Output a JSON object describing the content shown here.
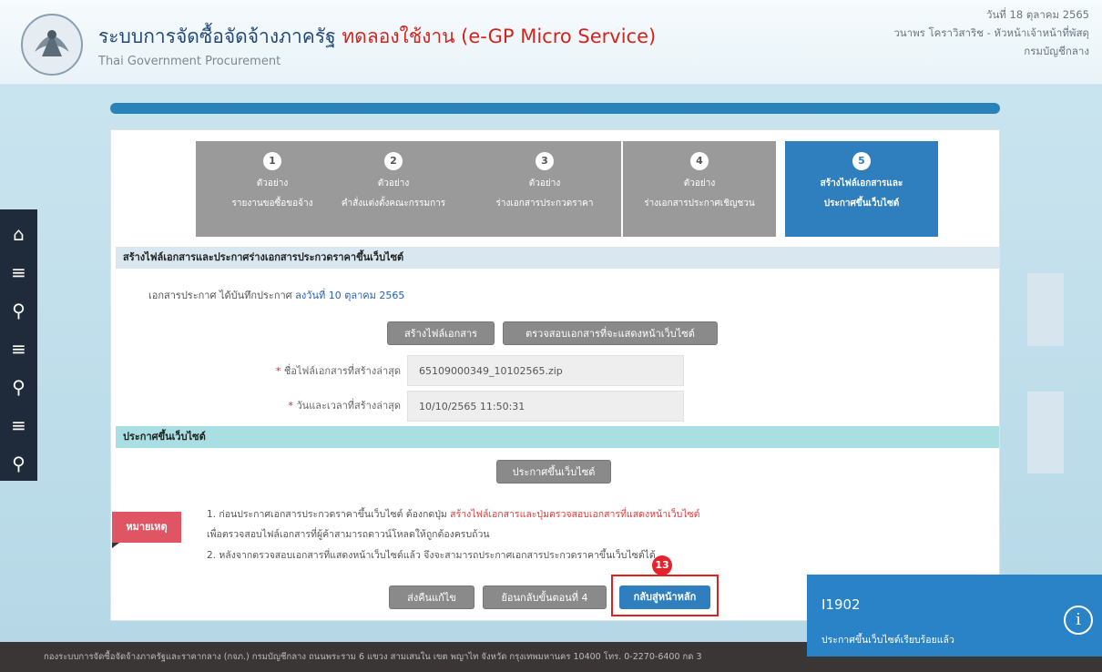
{
  "header": {
    "title": "ระบบการจัดซื้อจัดจ้างภาครัฐ",
    "trial_label": "ทดลองใช้งาน (e-GP Micro Service)",
    "subtitle": "Thai Government Procurement",
    "date": "วันที่ 18 ตุลาคม 2565",
    "user": "วนาพร โคราวิสาริช - หัวหน้าเจ้าหน้าที่พัสดุ",
    "department": "กรมบัญชีกลาง"
  },
  "steps": [
    {
      "num": "1",
      "line1": "ตัวอย่าง",
      "line2": "รายงานขอซื้อขอจ้าง"
    },
    {
      "num": "2",
      "line1": "ตัวอย่าง",
      "line2": "คำสั่งแต่งตั้งคณะกรรมการ"
    },
    {
      "num": "3",
      "line1": "ตัวอย่าง",
      "line2": "ร่างเอกสารประกวดราคา"
    },
    {
      "num": "4",
      "line1": "ตัวอย่าง",
      "line2": "ร่างเอกสารประกาศเชิญชวน"
    },
    {
      "num": "5",
      "line1": "สร้างไฟล์เอกสารและ",
      "line2": "ประกาศขึ้นเว็บไซต์"
    }
  ],
  "section1": {
    "title": "สร้างไฟล์เอกสารและประกาศร่างเอกสารประกวดราคาขึ้นเว็บไซต์",
    "info_prefix": "เอกสารประกาศ ได้บันทึกประกาศ",
    "info_date": "ลงวันที่ 10 ตุลาคม 2565",
    "create_file_button": "สร้างไฟล์เอกสาร",
    "check_doc_button": "ตรวจสอบเอกสารที่จะแสดงหน้าเว็บไซต์",
    "filename_label": "ชื่อไฟล์เอกสารที่สร้างล่าสุด",
    "filename_value": "65109000349_10102565.zip",
    "datetime_label": "วันและเวลาที่สร้างล่าสุด",
    "datetime_value": "10/10/2565 11:50:31"
  },
  "section2": {
    "title": "ประกาศขึ้นเว็บไซต์",
    "publish_button": "ประกาศขึ้นเว็บไซต์"
  },
  "note": {
    "tag": "หมายเหตุ",
    "line1_prefix": "1. ก่อนประกาศเอกสารประกวดราคาขึ้นเว็บไซต์ ต้องกดปุ่ม",
    "line1_red": "สร้างไฟล์เอกสารและปุ่มตรวจสอบเอกสารที่แสดงหน้าเว็บไซต์",
    "line2": "เพื่อตรวจสอบไฟล์เอกสารที่ผู้ค้าสามารถดาวน์โหลดให้ถูกต้องครบถ้วน",
    "line3": "2. หลังจากตรวจสอบเอกสารที่แสดงหน้าเว็บไซต์แล้ว จึงจะสามารถประกาศเอกสารประกวดราคาขึ้นเว็บไซต์ได้"
  },
  "actions": {
    "return_edit": "ส่งคืนแก้ไข",
    "back_step4": "ย้อนกลับขั้นตอนที่ 4",
    "home": "กลับสู่หน้าหลัก"
  },
  "annotation_badge": "13",
  "toast": {
    "code": "I1902",
    "message": "ประกาศขึ้นเว็บไซต์เรียบร้อยแล้ว",
    "icon": "info-icon"
  },
  "footer": "กองระบบการจัดซื้อจัดจ้างภาครัฐและราคากลาง (กจภ.) กรมบัญชีกลาง ถนนพระราม 6 แขวง สามเสนใน เขต พญาไท จังหวัด กรุงเทพมหานคร 10400 โทร. 0-2270-6400 กด 3",
  "colors": {
    "accent": "#2f7fbf",
    "step_inactive": "#9a9a9a",
    "note_red": "#e05563",
    "highlight": "#e02020",
    "footer_bg": "#3a3636"
  }
}
